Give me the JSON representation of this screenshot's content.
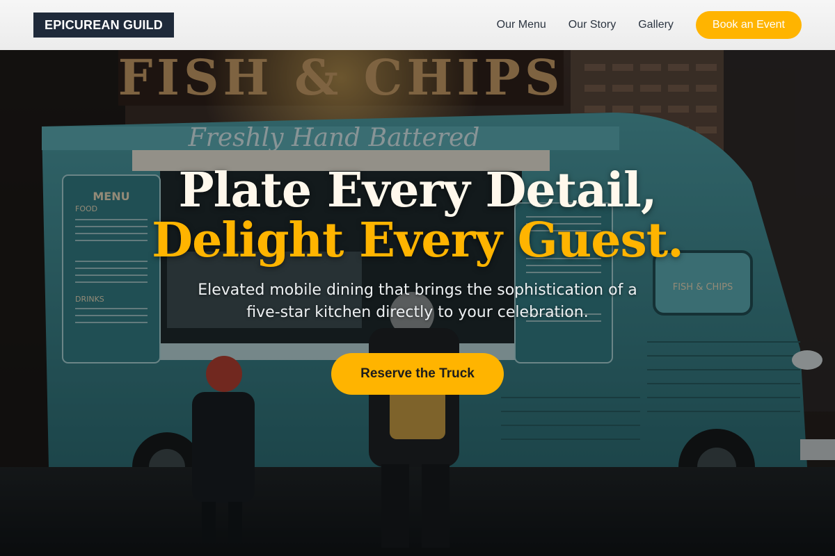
{
  "brand": {
    "name": "EPICUREAN GUILD"
  },
  "nav": {
    "links": [
      {
        "label": "Our Menu"
      },
      {
        "label": "Our Story"
      },
      {
        "label": "Gallery"
      }
    ],
    "cta_label": "Book an Event"
  },
  "hero": {
    "headline_line1": "Plate Every Detail,",
    "headline_line2": "Delight Every Guest.",
    "subheadline": "Elevated mobile dining that brings the sophistication of a five-star kitchen directly to your celebration.",
    "cta_label": "Reserve the Truck"
  },
  "background": {
    "sign": "FISH & CHIPS",
    "script_sign": "Freshly Hand Battered",
    "menu_title": "MENU",
    "menu_sections": [
      "FOOD",
      "DRINKS"
    ],
    "side_panel_text": "FISH & CHIPS"
  },
  "colors": {
    "accent": "#ffb400",
    "brand_dark": "#1f2a3a",
    "truck_teal": "#3f8f95"
  }
}
